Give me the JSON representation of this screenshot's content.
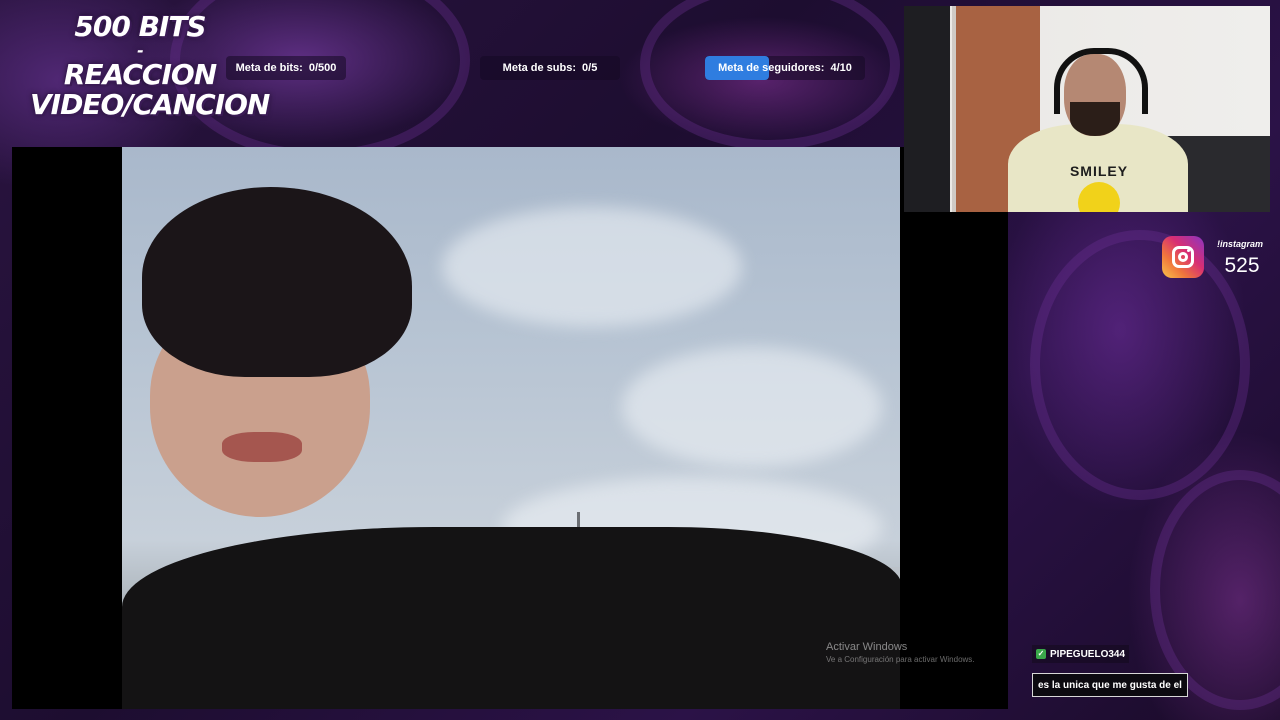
{
  "overlay": {
    "title_lines": [
      "500 BITS",
      "-",
      "REACCION",
      "VIDEO/CANCION"
    ]
  },
  "goals": [
    {
      "label": "Meta de bits:",
      "value": "0/500",
      "progress": 0.0
    },
    {
      "label": "Meta de subs:",
      "value": "0/5",
      "progress": 0.0
    },
    {
      "label": "Meta de seguidores:",
      "value": "4/10",
      "progress": 0.4
    }
  ],
  "webcam": {
    "shirt_text": "SMILEY"
  },
  "instagram": {
    "label": "!instagram",
    "count": "525",
    "icon": "instagram-icon"
  },
  "watermark": {
    "line1": "Activar Windows",
    "line2": "Ve a Configuración para activar Windows."
  },
  "chat": {
    "username": "PIPEGUELO344",
    "message": "es la unica que me gusta de el",
    "badge_icon": "check-badge-icon"
  },
  "colors": {
    "goal_fill": "#2f7de0",
    "background": "#1a0c2c"
  }
}
